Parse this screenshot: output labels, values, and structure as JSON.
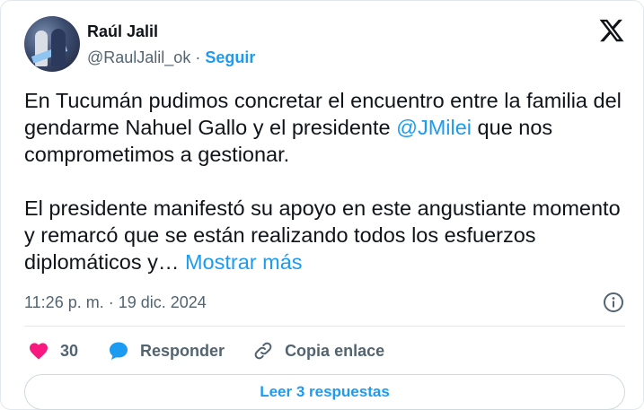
{
  "author": {
    "name": "Raúl Jalil",
    "handle": "@RaulJalil_ok",
    "separator": " · ",
    "follow_label": "Seguir"
  },
  "tweet": {
    "p1_before": "En Tucumán pudimos concretar el encuentro entre la familia del gendarme Nahuel Gallo y el presidente ",
    "mention": "@JMilei",
    "p1_after": " que nos comprometimos a gestionar.",
    "p2": "El presidente manifestó su apoyo en este angustiante momento y remarcó que se están realizando todos los esfuerzos diplomáticos y… ",
    "show_more": "Mostrar más"
  },
  "meta": {
    "time": "11:26 p. m.",
    "separator": " · ",
    "date": "19 dic. 2024"
  },
  "actions": {
    "likes": "30",
    "reply_label": "Responder",
    "copy_label": "Copia enlace"
  },
  "read_replies_label": "Leer 3 respuestas",
  "colors": {
    "accent": "#1d9bf0",
    "like": "#f91880",
    "muted": "#536471",
    "text": "#0f1419"
  },
  "icons": [
    "x-logo-icon",
    "info-icon",
    "heart-icon",
    "reply-bubble-icon",
    "link-icon"
  ]
}
